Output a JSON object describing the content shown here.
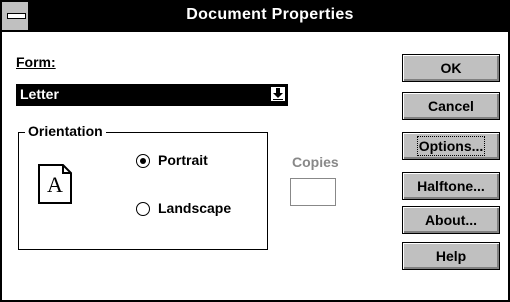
{
  "window": {
    "title": "Document Properties"
  },
  "form": {
    "label": "Form:",
    "selected": "Letter"
  },
  "orientation": {
    "group_label": "Orientation",
    "portrait_label": "Portrait",
    "landscape_label": "Landscape",
    "selected": "Portrait",
    "preview_letter": "A"
  },
  "copies": {
    "label": "Copies",
    "value": "",
    "enabled": false
  },
  "buttons": {
    "ok": "OK",
    "cancel": "Cancel",
    "options": "Options...",
    "halftone": "Halftone...",
    "about": "About...",
    "help": "Help"
  }
}
